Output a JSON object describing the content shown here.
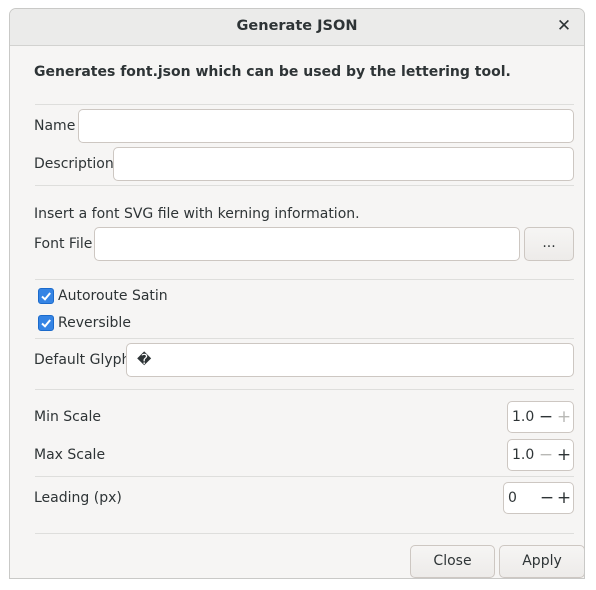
{
  "dialog": {
    "title": "Generate JSON",
    "close_glyph": "✕",
    "description": "Generates font.json which can be used by the lettering tool."
  },
  "form": {
    "name_label": "Name",
    "name_value": "",
    "description_label": "Description",
    "description_value": "",
    "font_hint": "Insert a font SVG file with kerning information.",
    "font_file_label": "Font File",
    "font_file_value": "",
    "browse_label": "...",
    "autoroute_label": "Autoroute Satin",
    "autoroute_checked": true,
    "reversible_label": "Reversible",
    "reversible_checked": true,
    "default_glyph_label": "Default Glyph",
    "default_glyph_value": "�",
    "min_scale_label": "Min Scale",
    "min_scale_value": "1.0",
    "max_scale_label": "Max Scale",
    "max_scale_value": "1.0",
    "leading_label": "Leading (px)",
    "leading_value": "0",
    "minus_glyph": "−",
    "plus_glyph": "+"
  },
  "footer": {
    "close_label": "Close",
    "apply_label": "Apply"
  },
  "colors": {
    "accent": "#3584e4",
    "window_bg": "#f6f5f4",
    "titlebar_bg": "#ebebea"
  }
}
